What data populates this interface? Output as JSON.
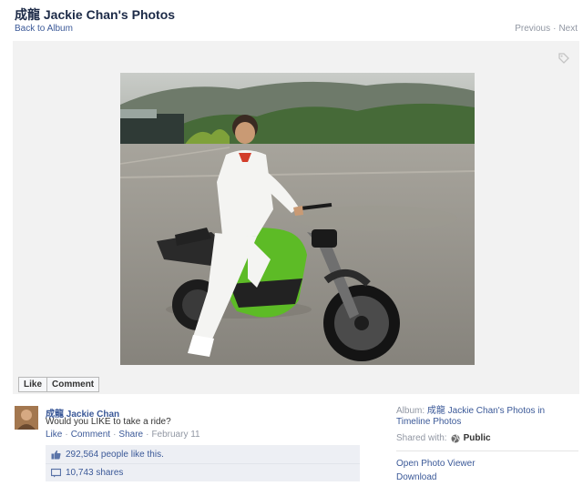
{
  "header": {
    "title": "成龍 Jackie Chan's Photos",
    "back_link": "Back to Album",
    "previous": "Previous",
    "separator": "·",
    "next": "Next"
  },
  "actions": {
    "like": "Like",
    "comment": "Comment"
  },
  "post": {
    "author": "成龍 Jackie Chan",
    "caption": "Would you LIKE to take a ride?",
    "meta_like": "Like",
    "meta_comment": "Comment",
    "meta_share": "Share",
    "dot": "·",
    "date": "February 11",
    "likes_text": "292,564 people like this.",
    "shares_text": "10,743 shares"
  },
  "sidebar": {
    "album_prefix": "Album:",
    "album_name": "成龍 Jackie Chan's Photos in Timeline Photos",
    "shared_with": "Shared with:",
    "privacy": "Public",
    "open_viewer": "Open Photo Viewer",
    "download": "Download"
  },
  "colors": {
    "link": "#3b5998",
    "meta_gray": "#9197a3",
    "likes_bg": "#edeff4",
    "stage_bg": "#f2f2f2",
    "bike_green": "#5dbb26"
  },
  "icons": {
    "tag": "tag-icon",
    "thumbs_up": "thumbs-up-icon",
    "share": "share-icon",
    "globe": "globe-icon"
  }
}
